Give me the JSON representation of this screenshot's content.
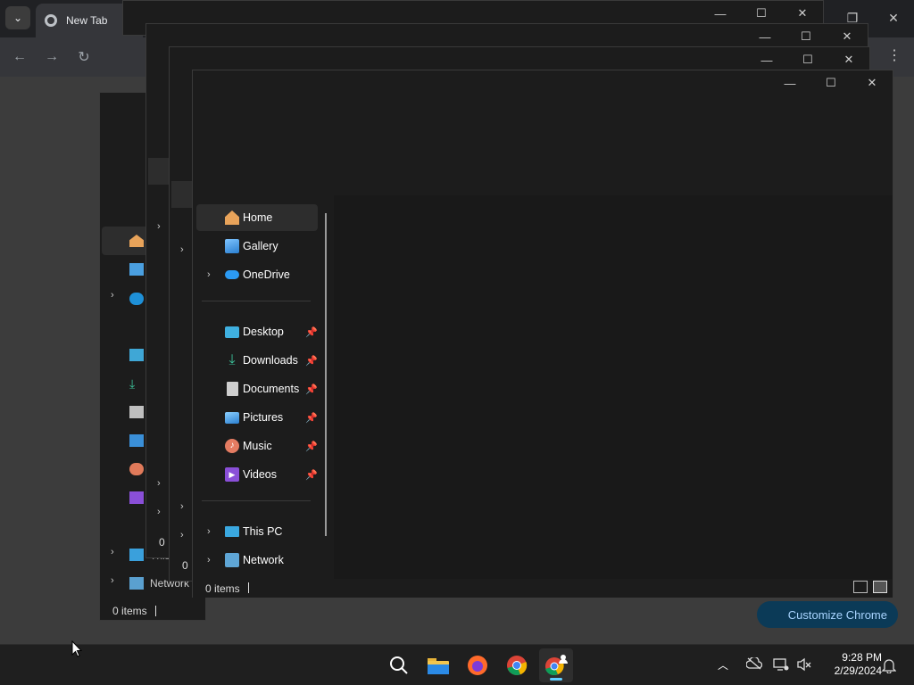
{
  "chrome": {
    "tab_title": "New Tab",
    "customize_label": "Customize Chrome"
  },
  "back_window": {
    "network_label": "Network",
    "this_pc_label": "This",
    "status": "0 items"
  },
  "explorer": {
    "nav": {
      "home": "Home",
      "gallery": "Gallery",
      "onedrive": "OneDrive",
      "desktop": "Desktop",
      "downloads": "Downloads",
      "documents": "Documents",
      "pictures": "Pictures",
      "music": "Music",
      "videos": "Videos",
      "this_pc": "This PC",
      "network": "Network"
    },
    "status": "0 items"
  },
  "taskbar": {
    "time": "9:28 PM",
    "date": "2/29/2024",
    "apps": [
      "search-icon",
      "file-explorer-icon",
      "firefox-icon",
      "chrome-icon",
      "chrome-profile-icon"
    ]
  },
  "colors": {
    "accent": "#60cdff",
    "folder": "#f3c64f"
  }
}
